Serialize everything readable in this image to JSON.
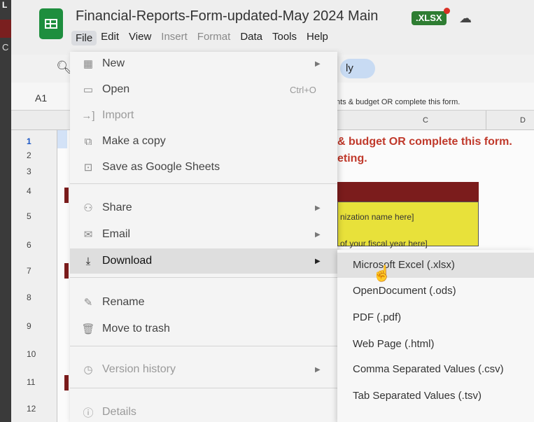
{
  "bezel": {
    "tab_letter": "C",
    "top_mark": "L"
  },
  "header": {
    "title": "Financial-Reports-Form-updated-May 2024 Main",
    "badge": ".XLSX",
    "menu": [
      "File",
      "Edit",
      "View",
      "Insert",
      "Format",
      "Data",
      "Tools",
      "Help"
    ]
  },
  "toolbar": {
    "pill_text": "ly"
  },
  "formula_bar": {
    "cell_ref": "A1",
    "content": "nts & budget OR complete this form."
  },
  "columns": {
    "c": "C",
    "d": "D"
  },
  "rows": [
    "1",
    "2",
    "3",
    "4",
    "5",
    "6",
    "7",
    "8",
    "9",
    "10",
    "11",
    "12"
  ],
  "sheet": {
    "red_line1": "& budget OR complete this form.",
    "red_line2": "eting.",
    "yellow_line1": "nization name here]",
    "yellow_line2": "of your fiscal year here]"
  },
  "file_menu": {
    "items": [
      {
        "label": "New",
        "icon": "new-icon",
        "shortcut": "",
        "arrow": true
      },
      {
        "label": "Open",
        "icon": "folder-icon",
        "shortcut": "Ctrl+O",
        "arrow": false
      },
      {
        "label": "Import",
        "icon": "import-icon",
        "shortcut": "",
        "arrow": false
      },
      {
        "label": "Make a copy",
        "icon": "copy-icon",
        "shortcut": "",
        "arrow": false
      },
      {
        "label": "Save as Google Sheets",
        "icon": "save-icon",
        "shortcut": "",
        "arrow": false
      },
      {
        "label": "Share",
        "icon": "share-icon",
        "shortcut": "",
        "arrow": true
      },
      {
        "label": "Email",
        "icon": "email-icon",
        "shortcut": "",
        "arrow": true
      },
      {
        "label": "Download",
        "icon": "download-icon",
        "shortcut": "",
        "arrow": true
      },
      {
        "label": "Rename",
        "icon": "rename-icon",
        "shortcut": "",
        "arrow": false
      },
      {
        "label": "Move to trash",
        "icon": "trash-icon",
        "shortcut": "",
        "arrow": false
      },
      {
        "label": "Version history",
        "icon": "history-icon",
        "shortcut": "",
        "arrow": true
      },
      {
        "label": "Details",
        "icon": "info-icon",
        "shortcut": "",
        "arrow": false
      }
    ]
  },
  "download_submenu": {
    "items": [
      "Microsoft Excel (.xlsx)",
      "OpenDocument (.ods)",
      "PDF (.pdf)",
      "Web Page (.html)",
      "Comma Separated Values (.csv)",
      "Tab Separated Values (.tsv)"
    ]
  },
  "colors": {
    "sheets_green": "#1e8e3e",
    "badge_green": "#2e7d32",
    "warning_red": "#c0392b",
    "maroon": "#7b1c1c",
    "highlight_yellow": "#e8e13a"
  }
}
